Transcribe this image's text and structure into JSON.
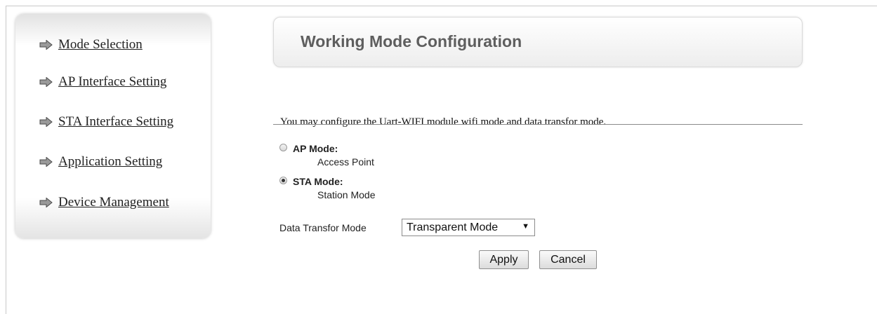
{
  "sidebar": {
    "items": [
      {
        "label": "Mode Selection",
        "icon": "arrow-right-icon"
      },
      {
        "label": "AP Interface Setting",
        "icon": "arrow-right-icon"
      },
      {
        "label": "STA Interface Setting",
        "icon": "arrow-right-icon"
      },
      {
        "label": "Application Setting",
        "icon": "arrow-right-icon"
      },
      {
        "label": "Device Management",
        "icon": "arrow-right-icon"
      }
    ]
  },
  "main": {
    "title": "Working Mode Configuration",
    "description": "You may configure the Uart-WIFI module wifi mode and data transfor mode.",
    "modes": [
      {
        "label": "AP Mode:",
        "description": "Access Point",
        "selected": false
      },
      {
        "label": "STA Mode:",
        "description": "Station Mode",
        "selected": true
      }
    ],
    "data_transfer": {
      "label": "Data Transfor Mode",
      "selected": "Transparent Mode",
      "caret": "▼"
    },
    "buttons": {
      "apply": "Apply",
      "cancel": "Cancel"
    }
  },
  "colors": {
    "title_text": "#5e5e5e",
    "divider": "#8a8a8a"
  }
}
